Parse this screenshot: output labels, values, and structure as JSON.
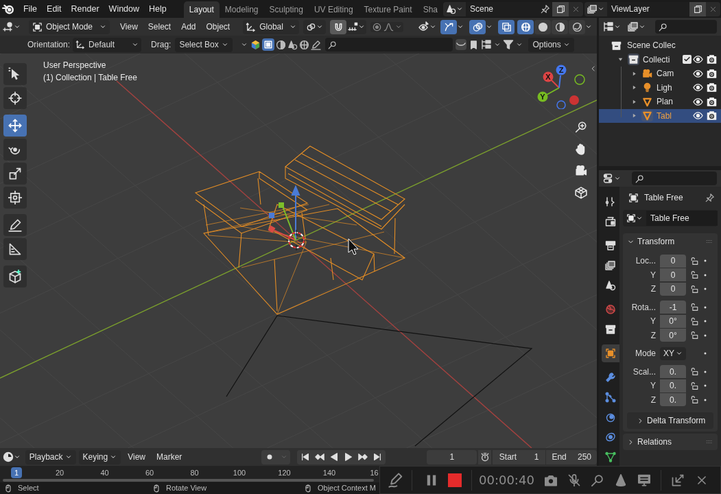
{
  "menu": [
    "File",
    "Edit",
    "Render",
    "Window",
    "Help"
  ],
  "workspaces": [
    {
      "label": "Layout",
      "selected": true
    },
    {
      "label": "Modeling",
      "selected": false
    },
    {
      "label": "Sculpting",
      "selected": false
    },
    {
      "label": "UV Editing",
      "selected": false
    },
    {
      "label": "Texture Paint",
      "selected": false
    },
    {
      "label": "Sha",
      "selected": false
    }
  ],
  "scene": "Scene",
  "view_layer": "ViewLayer",
  "viewport_header": {
    "mode": "Object Mode",
    "menus": [
      "View",
      "Select",
      "Add",
      "Object"
    ],
    "orientation": "Global",
    "snap_on": true,
    "gizmos_on": true,
    "overlays_on": true,
    "xray_on": true,
    "shading": [
      {
        "kind": "wireframe",
        "selected": true
      },
      {
        "kind": "solid",
        "selected": false
      },
      {
        "kind": "material",
        "selected": false
      },
      {
        "kind": "rendered",
        "selected": false
      }
    ]
  },
  "tool_settings": {
    "orientation_label": "Orientation:",
    "orientation": "Default",
    "drag_label": "Drag:",
    "drag": "Select Box",
    "options": "Options"
  },
  "toolbar": [
    {
      "kind": "select",
      "selected": false
    },
    {
      "kind": "cursor",
      "selected": false
    },
    {
      "kind": "move",
      "selected": true
    },
    {
      "kind": "rotate",
      "selected": false
    },
    {
      "kind": "scale",
      "selected": false
    },
    {
      "kind": "transform",
      "selected": false
    },
    {
      "kind": "annotate",
      "selected": false
    },
    {
      "kind": "measure",
      "selected": false
    },
    {
      "kind": "add-cube",
      "selected": false
    }
  ],
  "viewport": {
    "view_name": "User Perspective",
    "context": "(1) Collection | Table Free",
    "axes": [
      "X",
      "Y",
      "Z"
    ]
  },
  "outliner": {
    "root": "Scene Collec",
    "tree": [
      {
        "label": "Collecti",
        "kind": "collection",
        "expanded": true,
        "checked": true,
        "selected": false,
        "children": [
          {
            "label": "Cam",
            "kind": "camera",
            "selected": false
          },
          {
            "label": "Ligh",
            "kind": "light",
            "selected": false
          },
          {
            "label": "Plan",
            "kind": "mesh",
            "selected": false
          },
          {
            "label": "Tabl",
            "kind": "mesh",
            "selected": true
          }
        ]
      }
    ]
  },
  "properties": {
    "tabs": [
      {
        "kind": "tool",
        "selected": false
      },
      {
        "kind": "render",
        "selected": false
      },
      {
        "kind": "output",
        "selected": false
      },
      {
        "kind": "view-layer",
        "selected": false
      },
      {
        "kind": "scene",
        "selected": false
      },
      {
        "kind": "world",
        "selected": false
      },
      {
        "kind": "collection",
        "selected": false
      },
      {
        "kind": "object",
        "selected": true
      },
      {
        "kind": "modifiers",
        "selected": false
      },
      {
        "kind": "particles",
        "selected": false
      },
      {
        "kind": "physics",
        "selected": false
      },
      {
        "kind": "constraints",
        "selected": false
      },
      {
        "kind": "data",
        "selected": false
      }
    ],
    "object_name": "Table Free",
    "data_name": "Table Free",
    "panel": {
      "title": "Transform",
      "expanded": true,
      "groups": [
        {
          "rows": [
            {
              "label": "Loc...",
              "value": "0",
              "kind": "number"
            },
            {
              "label": "Y",
              "value": "0",
              "kind": "number"
            },
            {
              "label": "Z",
              "value": "0",
              "kind": "number"
            }
          ]
        },
        {
          "rows": [
            {
              "label": "Rota...",
              "value": "-1",
              "kind": "number"
            },
            {
              "label": "Y",
              "value": "0°",
              "kind": "number"
            },
            {
              "label": "Z",
              "value": "0°",
              "kind": "number"
            }
          ]
        },
        {
          "rows": [
            {
              "label": "Mode",
              "value": "XY",
              "kind": "dropdown"
            }
          ]
        },
        {
          "rows": [
            {
              "label": "Scal...",
              "value": "0.",
              "kind": "number"
            },
            {
              "label": "Y",
              "value": "0.",
              "kind": "number"
            },
            {
              "label": "Z",
              "value": "0.",
              "kind": "number"
            }
          ]
        }
      ],
      "subpanel": {
        "title": "Delta Transform",
        "expanded": false
      }
    },
    "next_panel": {
      "title": "Relations",
      "expanded": false
    }
  },
  "timeline": {
    "menus": [
      {
        "label": "Playback",
        "dropdown": true
      },
      {
        "label": "Keying",
        "dropdown": true
      },
      {
        "label": "View",
        "dropdown": false
      },
      {
        "label": "Marker",
        "dropdown": false
      }
    ],
    "auto_key_on": false,
    "current_frame": "1",
    "start_label": "Start",
    "start": "1",
    "end_label": "End",
    "end": "250",
    "ruler": [
      "1",
      "20",
      "40",
      "60",
      "80",
      "100",
      "120",
      "140",
      "16"
    ]
  },
  "status_bar": [
    "Select",
    "Rotate View",
    "Object Context M"
  ],
  "recorder": {
    "time": "00:00:40",
    "recording": true
  }
}
